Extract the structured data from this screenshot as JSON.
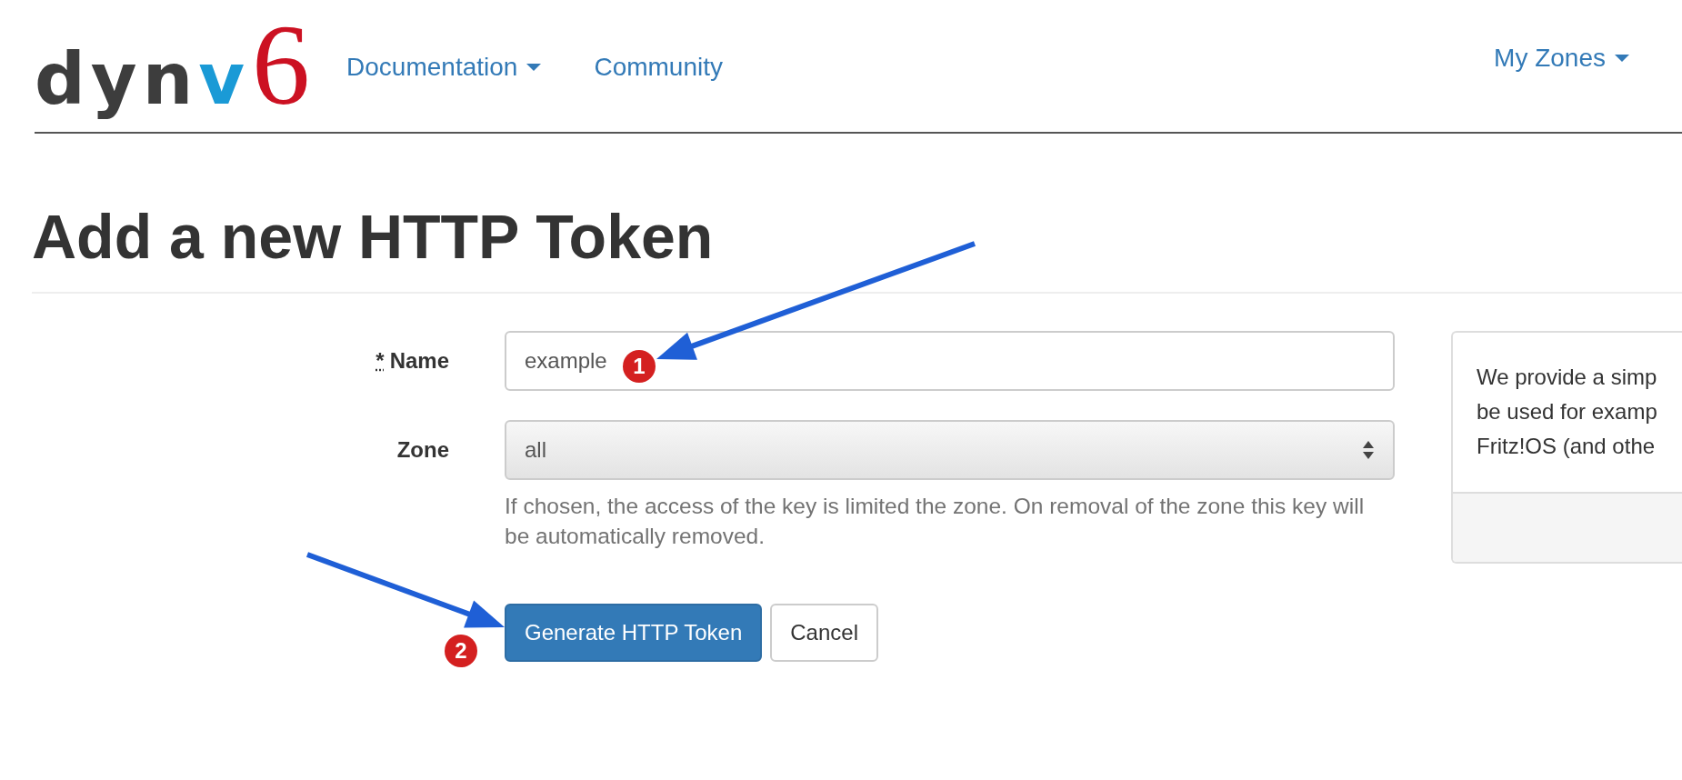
{
  "logo": [
    {
      "text": "dyn",
      "color": "#3d3d3d"
    },
    {
      "text": "v",
      "color": "#1a9ad6"
    },
    {
      "text": "6",
      "color": "#cc1122"
    }
  ],
  "nav": [
    {
      "label": "Documentation",
      "dropdown": true
    },
    {
      "label": "Community",
      "dropdown": false
    }
  ],
  "nav_right": [
    {
      "label": "My Zones",
      "dropdown": true
    }
  ],
  "title": "Add a new HTTP Token",
  "form": {
    "fields": [
      {
        "kind": "text",
        "label": "Name",
        "required_mark": "*",
        "value": "example"
      },
      {
        "kind": "select",
        "label": "Zone",
        "value": "all",
        "help": "If chosen, the access of the key is limited the zone. On removal of the zone this key will be automatically removed."
      }
    ],
    "buttons": [
      {
        "label": "Generate HTTP Token",
        "primary": true
      },
      {
        "label": "Cancel",
        "primary": false
      }
    ]
  },
  "info_panel": {
    "lines": [
      "We provide a simp",
      "be used for examp",
      "Fritz!OS (and othe"
    ]
  },
  "annotations": [
    {
      "number": "1"
    },
    {
      "number": "2"
    }
  ]
}
